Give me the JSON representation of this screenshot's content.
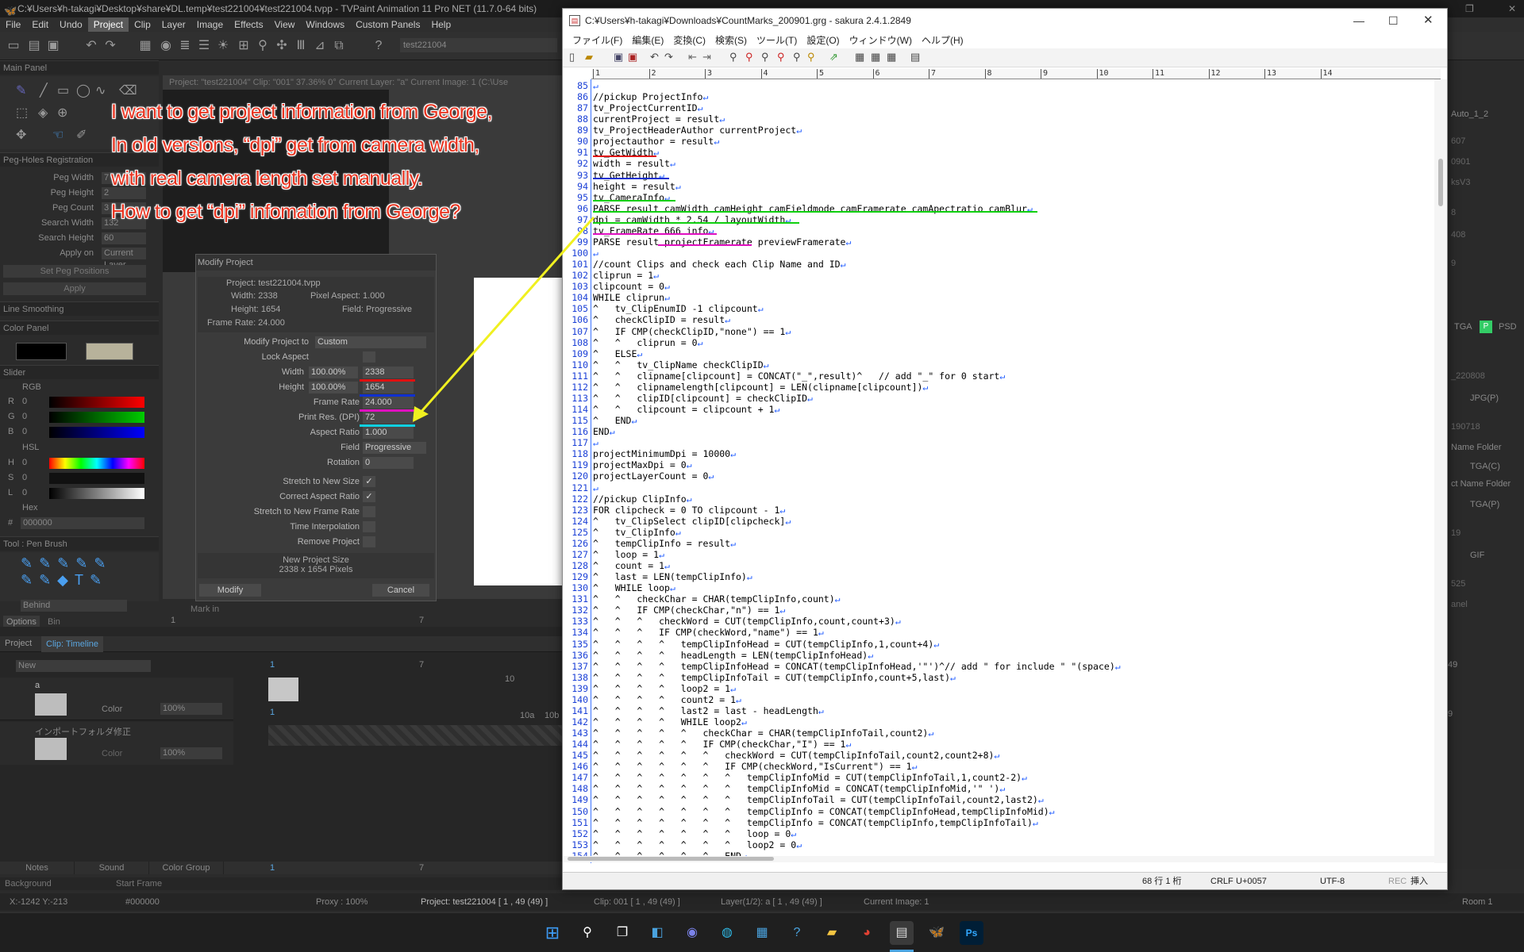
{
  "tvpaint": {
    "title": "C:¥Users¥h-takagi¥Desktop¥share¥DL.temp¥test221004¥test221004.tvpp - TVPaint Animation 11 Pro NET (11.7.0-64 bits)",
    "menu": [
      "File",
      "Edit",
      "Undo",
      "Project",
      "Clip",
      "Layer",
      "Image",
      "Effects",
      "View",
      "Windows",
      "Custom Panels",
      "Help"
    ],
    "project_field": "test221004",
    "main_panel_label": "Main Panel",
    "info_line": "Project: \"test221004\"   Clip: \"001\"   37.36%   0°   Current Layer: \"a\"   Current Image: 1 (C:\\Use",
    "peg_holes": {
      "header": "Peg-Holes Registration",
      "rows": [
        {
          "label": "Peg Width",
          "value": "7"
        },
        {
          "label": "Peg Height",
          "value": "2"
        },
        {
          "label": "Peg Count",
          "value": "3"
        },
        {
          "label": "Search Width",
          "value": "132"
        },
        {
          "label": "Search Height",
          "value": "60"
        },
        {
          "label": "Apply on",
          "value": "Current Layer"
        }
      ],
      "set_positions": "Set Peg Positions",
      "apply": "Apply"
    },
    "line_smoothing": "Line Smoothing",
    "color_panel": "Color Panel",
    "slider": {
      "header": "Slider",
      "rgb": "RGB",
      "r": "R",
      "g": "G",
      "b": "B",
      "r_val": "0",
      "g_val": "0",
      "b_val": "0",
      "hsl": "HSL",
      "h": "H",
      "s": "S",
      "l": "L",
      "h_val": "0",
      "s_val": "0",
      "l_val": "0",
      "hex_label": "Hex",
      "hex_val": "000000",
      "hex_prefix": "#"
    },
    "tool_label": "Tool : Pen Brush",
    "behind": "Behind",
    "options_tab": "Options",
    "bin_tab": "Bin",
    "project_tab": "Project",
    "clip_timeline_tab": "Clip: Timeline",
    "timeline": {
      "new": "New",
      "layer_a": "a",
      "layer_b": "インポートフォルダ修正",
      "color_label": "Color",
      "opacity": "100%",
      "marker_1": "1",
      "marker_7": "7",
      "marker_10": "10",
      "marker_10a": "10a",
      "marker_10b": "10b",
      "bottom_tabs": [
        "Notes",
        "Sound",
        "Color Group"
      ],
      "background": "Background",
      "start_frame": "Start Frame",
      "frame_start": "1",
      "frame_7": "7",
      "frame_49": "49",
      "mark_in": "Mark in",
      "track_1": "1",
      "track_7": "7"
    },
    "statusbar": {
      "coords": "X:-1242  Y:-213",
      "color": "#000000",
      "proxy": "Proxy : 100%",
      "project": "Project: test221004 [ 1 , 49  (49) ]",
      "clip": "Clip: 001 [ 1 , 49  (49) ]",
      "layer": "Layer(1/2): a [ 1 , 49  (49) ]",
      "current_image": "Current Image: 1",
      "room": "Room 1"
    },
    "right_panel": {
      "auto": "Auto_1_2",
      "r1": "607",
      "r2": "0901",
      "r3": "ksV3",
      "r4": "8",
      "r5": "408",
      "r6": "9",
      "tga": "TGA",
      "psd": "PSD",
      "r7": "_220808",
      "jpg": "JPG(P)",
      "r8": "190718",
      "name_folder": "Name Folder",
      "tga_c": "TGA(C)",
      "proj_name_folder": "ct Name Folder",
      "tga_p": "TGA(P)",
      "r9": "19",
      "gif": "GIF",
      "r10": "525",
      "panel": "anel",
      "n49": "49",
      "n9": "9"
    }
  },
  "dialog": {
    "title": "Modify Project",
    "project": "Project: test221004.tvpp",
    "width_line": "Width: 2338",
    "pixel_aspect": "Pixel Aspect: 1.000",
    "height_line": "Height: 1654",
    "field_line": "Field: Progressive",
    "frame_rate_line": "Frame Rate: 24.000",
    "modify_to_label": "Modify Project to",
    "modify_to_value": "Custom",
    "lock_aspect": "Lock Aspect",
    "width_label": "Width",
    "width_pct": "100.00%",
    "width_val": "2338",
    "height_label": "Height",
    "height_pct": "100.00%",
    "height_val": "1654",
    "frame_rate_label": "Frame Rate",
    "frame_rate_val": "24.000",
    "dpi_label": "Print Res. (DPI)",
    "dpi_val": "72",
    "aspect_label": "Aspect Ratio",
    "aspect_val": "1.000",
    "field_label": "Field",
    "field_val": "Progressive",
    "rotation_label": "Rotation",
    "rotation_val": "0",
    "stretch_label": "Stretch to New Size",
    "correct_aspect_label": "Correct Aspect Ratio",
    "stretch_fr_label": "Stretch to New Frame Rate",
    "time_interp_label": "Time Interpolation",
    "remove_label": "Remove Project",
    "check": "✓",
    "new_size_label": "New Project Size",
    "new_size_val": "2338 x 1654 Pixels",
    "modify_btn": "Modify",
    "cancel_btn": "Cancel"
  },
  "annotation": {
    "lines": [
      "I want to get project information from George,",
      "In old versions, “dpi” get from camera width,",
      "with real camera length set manually.",
      "How to get “dpi” infomation from George?"
    ],
    "color": "#e8321e"
  },
  "sakura": {
    "title": "C:¥Users¥h-takagi¥Downloads¥CountMarks_200901.grg - sakura 2.4.1.2849",
    "menu": [
      "ファイル(F)",
      "編集(E)",
      "変換(C)",
      "検索(S)",
      "ツール(T)",
      "設定(O)",
      "ウィンドウ(W)",
      "ヘルプ(H)"
    ],
    "ruler_marks": [
      "1",
      "2",
      "3",
      "4",
      "5",
      "6",
      "7",
      "8",
      "9",
      "10",
      "11",
      "12",
      "13",
      "14"
    ],
    "code": [
      {
        "n": "85",
        "t": ""
      },
      {
        "n": "86",
        "t": "//pickup ProjectInfo"
      },
      {
        "n": "87",
        "t": "tv_ProjectCurrentID"
      },
      {
        "n": "88",
        "t": "currentProject = result"
      },
      {
        "n": "89",
        "t": "tv_ProjectHeaderAuthor currentProject"
      },
      {
        "n": "90",
        "t": "projectauthor = result"
      },
      {
        "n": "91",
        "t": "tv_GetWidth"
      },
      {
        "n": "92",
        "t": "width = result"
      },
      {
        "n": "93",
        "t": "tv_GetHeight"
      },
      {
        "n": "94",
        "t": "height = result"
      },
      {
        "n": "95",
        "t": "tv_CameraInfo"
      },
      {
        "n": "96",
        "t": "PARSE result camWidth camHeight camFieldmode camFramerate camApectratio camBlur"
      },
      {
        "n": "97",
        "t": "dpi = camWidth * 2.54 / layoutWidth"
      },
      {
        "n": "98",
        "t": "tv_FrameRate 666 info"
      },
      {
        "n": "99",
        "t": "PARSE result projectFramerate previewFramerate"
      },
      {
        "n": "100",
        "t": ""
      },
      {
        "n": "101",
        "t": "//count Clips and check each Clip Name and ID"
      },
      {
        "n": "102",
        "t": "cliprun = 1"
      },
      {
        "n": "103",
        "t": "clipcount = 0"
      },
      {
        "n": "104",
        "t": "WHILE cliprun"
      },
      {
        "n": "105",
        "t": "^   tv_ClipEnumID -1 clipcount"
      },
      {
        "n": "106",
        "t": "^   checkClipID = result"
      },
      {
        "n": "107",
        "t": "^   IF CMP(checkClipID,\"none\") == 1"
      },
      {
        "n": "108",
        "t": "^   ^   cliprun = 0"
      },
      {
        "n": "109",
        "t": "^   ELSE"
      },
      {
        "n": "110",
        "t": "^   ^   tv_ClipName checkClipID"
      },
      {
        "n": "111",
        "t": "^   ^   clipname[clipcount] = CONCAT(\"_\",result)^   // add \"_\" for 0 start"
      },
      {
        "n": "112",
        "t": "^   ^   clipnamelength[clipcount] = LEN(clipname[clipcount])"
      },
      {
        "n": "113",
        "t": "^   ^   clipID[clipcount] = checkClipID"
      },
      {
        "n": "114",
        "t": "^   ^   clipcount = clipcount + 1"
      },
      {
        "n": "115",
        "t": "^   END"
      },
      {
        "n": "116",
        "t": "END"
      },
      {
        "n": "117",
        "t": ""
      },
      {
        "n": "118",
        "t": "projectMinimumDpi = 10000"
      },
      {
        "n": "119",
        "t": "projectMaxDpi = 0"
      },
      {
        "n": "120",
        "t": "projectLayerCount = 0"
      },
      {
        "n": "121",
        "t": ""
      },
      {
        "n": "122",
        "t": "//pickup ClipInfo"
      },
      {
        "n": "123",
        "t": "FOR clipcheck = 0 TO clipcount - 1"
      },
      {
        "n": "124",
        "t": "^   tv_ClipSelect clipID[clipcheck]"
      },
      {
        "n": "125",
        "t": "^   tv_ClipInfo"
      },
      {
        "n": "126",
        "t": "^   tempClipInfo = result"
      },
      {
        "n": "127",
        "t": "^   loop = 1"
      },
      {
        "n": "128",
        "t": "^   count = 1"
      },
      {
        "n": "129",
        "t": "^   last = LEN(tempClipInfo)"
      },
      {
        "n": "130",
        "t": "^   WHILE loop"
      },
      {
        "n": "131",
        "t": "^   ^   checkChar = CHAR(tempClipInfo,count)"
      },
      {
        "n": "132",
        "t": "^   ^   IF CMP(checkChar,\"n\") == 1"
      },
      {
        "n": "133",
        "t": "^   ^   ^   checkWord = CUT(tempClipInfo,count,count+3)"
      },
      {
        "n": "134",
        "t": "^   ^   ^   IF CMP(checkWord,\"name\") == 1"
      },
      {
        "n": "135",
        "t": "^   ^   ^   ^   tempClipInfoHead = CUT(tempClipInfo,1,count+4)"
      },
      {
        "n": "136",
        "t": "^   ^   ^   ^   headLength = LEN(tempClipInfoHead)"
      },
      {
        "n": "137",
        "t": "^   ^   ^   ^   tempClipInfoHead = CONCAT(tempClipInfoHead,'\"')^// add \" for include \" \"(space)"
      },
      {
        "n": "138",
        "t": "^   ^   ^   ^   tempClipInfoTail = CUT(tempClipInfo,count+5,last)"
      },
      {
        "n": "139",
        "t": "^   ^   ^   ^   loop2 = 1"
      },
      {
        "n": "140",
        "t": "^   ^   ^   ^   count2 = 1"
      },
      {
        "n": "141",
        "t": "^   ^   ^   ^   last2 = last - headLength"
      },
      {
        "n": "142",
        "t": "^   ^   ^   ^   WHILE loop2"
      },
      {
        "n": "143",
        "t": "^   ^   ^   ^   ^   checkChar = CHAR(tempClipInfoTail,count2)"
      },
      {
        "n": "144",
        "t": "^   ^   ^   ^   ^   IF CMP(checkChar,\"I\") == 1"
      },
      {
        "n": "145",
        "t": "^   ^   ^   ^   ^   ^   checkWord = CUT(tempClipInfoTail,count2,count2+8)"
      },
      {
        "n": "146",
        "t": "^   ^   ^   ^   ^   ^   IF CMP(checkWord,\"IsCurrent\") == 1"
      },
      {
        "n": "147",
        "t": "^   ^   ^   ^   ^   ^   ^   tempClipInfoMid = CUT(tempClipInfoTail,1,count2-2)"
      },
      {
        "n": "148",
        "t": "^   ^   ^   ^   ^   ^   ^   tempClipInfoMid = CONCAT(tempClipInfoMid,'\" ')"
      },
      {
        "n": "149",
        "t": "^   ^   ^   ^   ^   ^   ^   tempClipInfoTail = CUT(tempClipInfoTail,count2,last2)"
      },
      {
        "n": "150",
        "t": "^   ^   ^   ^   ^   ^   ^   tempClipInfo = CONCAT(tempClipInfoHead,tempClipInfoMid)"
      },
      {
        "n": "151",
        "t": "^   ^   ^   ^   ^   ^   ^   tempClipInfo = CONCAT(tempClipInfo,tempClipInfoTail)"
      },
      {
        "n": "152",
        "t": "^   ^   ^   ^   ^   ^   ^   loop = 0"
      },
      {
        "n": "153",
        "t": "^   ^   ^   ^   ^   ^   ^   loop2 = 0"
      },
      {
        "n": "154",
        "t": "^   ^   ^   ^   ^   ^   END"
      }
    ],
    "status": {
      "line_col": "68 行   1 桁",
      "eol": "CRLF",
      "codepoint": "U+0057",
      "encoding": "UTF-8",
      "rec": "REC",
      "mode": "挿入"
    },
    "colors": {
      "line_numbers": "#1a3fd6",
      "crlf": "#1f5bff"
    }
  },
  "highlight_colors": {
    "red": "#e01010",
    "blue": "#1030d0",
    "green": "#10d010",
    "magenta": "#e010c0",
    "cyan": "#10d0e0",
    "arrow": "#f0f020"
  },
  "taskbar": {
    "icons": [
      "windows-start-icon",
      "search-icon",
      "task-view-icon",
      "widgets-icon",
      "teams-icon",
      "edge-icon",
      "store-icon",
      "help-icon",
      "explorer-icon",
      "chrome-icon",
      "sakura-icon",
      "tvpaint-icon",
      "photoshop-icon"
    ],
    "ps_label": "Ps"
  }
}
